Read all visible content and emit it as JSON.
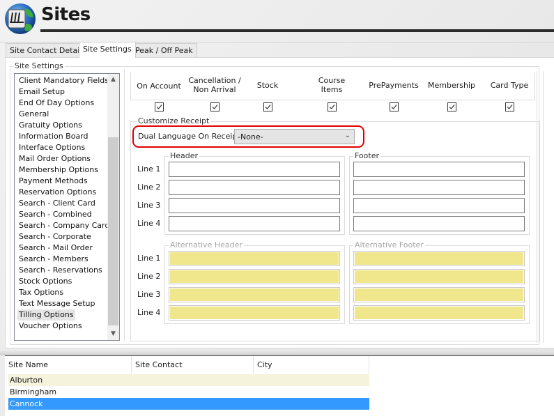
{
  "header": {
    "title": "Sites",
    "logo_icon": "globe-network-icon"
  },
  "tabs": [
    {
      "label": "Site Contact Details",
      "active": false
    },
    {
      "label": "Site Settings",
      "active": true
    },
    {
      "label": "Peak / Off Peak",
      "active": false
    }
  ],
  "site_settings": {
    "group_label": "Site Settings",
    "items": [
      "Client Mandatory Fields",
      "Email Setup",
      "End Of Day Options",
      "General",
      "Gratuity Options",
      "Information Board",
      "Interface Options",
      "Mail Order Options",
      "Membership Options",
      "Payment Methods",
      "Reservation Options",
      "Search - Client Card",
      "Search - Combined",
      "Search - Company Card",
      "Search - Corporate",
      "Search - Mail Order",
      "Search - Members",
      "Search - Reservations",
      "Stock Options",
      "Tax Options",
      "Text Message Setup",
      "Tilling Options",
      "Voucher Options"
    ],
    "selected_item": "Tilling Options"
  },
  "payment_types": [
    {
      "label_line1": "",
      "label_line2": "On Account",
      "checked": true
    },
    {
      "label_line1": "Cancellation /",
      "label_line2": "Non Arrival",
      "checked": true
    },
    {
      "label_line1": "",
      "label_line2": "Stock",
      "checked": true
    },
    {
      "label_line1": "Course",
      "label_line2": "Items",
      "checked": true
    },
    {
      "label_line1": "",
      "label_line2": "PrePayments",
      "checked": true
    },
    {
      "label_line1": "",
      "label_line2": "Membership",
      "checked": true
    },
    {
      "label_line1": "",
      "label_line2": "Card Type",
      "checked": true
    }
  ],
  "customize_receipt": {
    "group_label": "Customize Receipt",
    "dual_language_label": "Dual Language On Receipt",
    "dual_language_value": "-None-",
    "header_label": "Header",
    "footer_label": "Footer",
    "alt_header_label": "Alternative Header",
    "alt_footer_label": "Alternative Footer",
    "line_labels": [
      "Line 1",
      "Line 2",
      "Line 3",
      "Line 4"
    ],
    "header_lines": [
      "",
      "",
      "",
      ""
    ],
    "footer_lines": [
      "",
      "",
      "",
      ""
    ],
    "alt_header_lines": [
      "",
      "",
      "",
      ""
    ],
    "alt_footer_lines": [
      "",
      "",
      "",
      ""
    ]
  },
  "sites_grid": {
    "columns": [
      "Site Name",
      "Site Contact",
      "City"
    ],
    "rows": [
      {
        "site_name": "Alburton",
        "site_contact": "",
        "city": ""
      },
      {
        "site_name": "Birmingham",
        "site_contact": "",
        "city": ""
      },
      {
        "site_name": "Cannock",
        "site_contact": "",
        "city": ""
      }
    ],
    "selected_row": "Cannock"
  },
  "colors": {
    "highlight_ring": "#e10000",
    "selected_row": "#3399ff",
    "alt_input_fill": "#f0e68c",
    "alt_row": "#f5f3dc"
  }
}
